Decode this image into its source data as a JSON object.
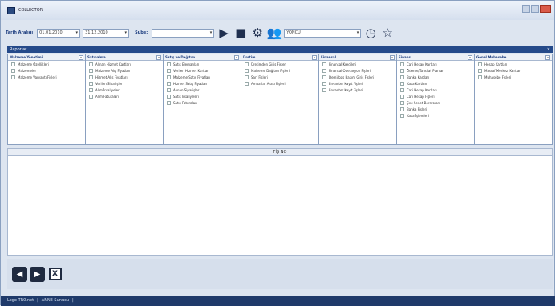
{
  "window": {
    "title": "COLLECTOR"
  },
  "toolbar": {
    "date_label": "Tarih Aralığı",
    "date_from": "01.01.2010",
    "date_to": "31.12.2010",
    "branch_label": "Şube:",
    "branch_value": "",
    "user_value": "YÖNCÜ",
    "icons": [
      "play-icon",
      "stop-icon",
      "settings-icon",
      "users-icon",
      "history-icon",
      "star-icon"
    ]
  },
  "section": {
    "title": "Raporlar"
  },
  "panels": [
    {
      "title": "Malzeme Yönetimi",
      "items": [
        "Malzeme Özellikleri",
        "Malzemeler",
        "Malzeme Varyantı Fişleri"
      ]
    },
    {
      "title": "Satınalma",
      "items": [
        "Alınan Hizmet Kartları",
        "Malzeme Alış Fiyatları",
        "Hizmet Alış Fiyatları",
        "Verilen Siparişler",
        "Alım İrsaliyeleri",
        "Alım Faturaları"
      ]
    },
    {
      "title": "Satış ve Dağıtım",
      "items": [
        "Satış Elemanları",
        "Verilen Hizmet Kartları",
        "Malzeme Satış Fiyatları",
        "Hizmet Satış Fiyatları",
        "Alınan Siparişler",
        "Satış İrsaliyeleri",
        "Satış Faturaları"
      ]
    },
    {
      "title": "Üretim",
      "items": [
        "Üretimden Giriş Fişleri",
        "Malzeme Dağıtım Fişleri",
        "Sarf Fişleri",
        "Ambarlar Arası Fişleri"
      ]
    },
    {
      "title": "Finansal",
      "items": [
        "Finansal Kredileri",
        "Finansal Operasyon Fişleri",
        "Demirbaş Bakım Giriş Fişleri",
        "Envanter Kayıt Fişleri",
        "Envanter Kayıt Fişleri"
      ]
    },
    {
      "title": "Finans",
      "items": [
        "Cari Hesap Kartları",
        "Ödeme/Tahsilat Planları",
        "Banka Kartları",
        "Kasa Kartları",
        "Cari Hesap Kartları",
        "Cari Hesap Fişleri",
        "Çek Senet Bordroları",
        "Banka Fişleri",
        "Kasa İşlemleri"
      ]
    },
    {
      "title": "Genel Muhasebe",
      "items": [
        "Hesap Kartları",
        "Masraf Merkezi Kartları",
        "Muhasebe Fişleri"
      ]
    }
  ],
  "report": {
    "header": "FİŞ NO"
  },
  "bottom": {
    "prev_icon": "◀",
    "next_icon": "▶",
    "excel_label": "X"
  },
  "status": {
    "items": [
      "Logo TR0.net",
      "ANNE Sunucu",
      ""
    ]
  }
}
